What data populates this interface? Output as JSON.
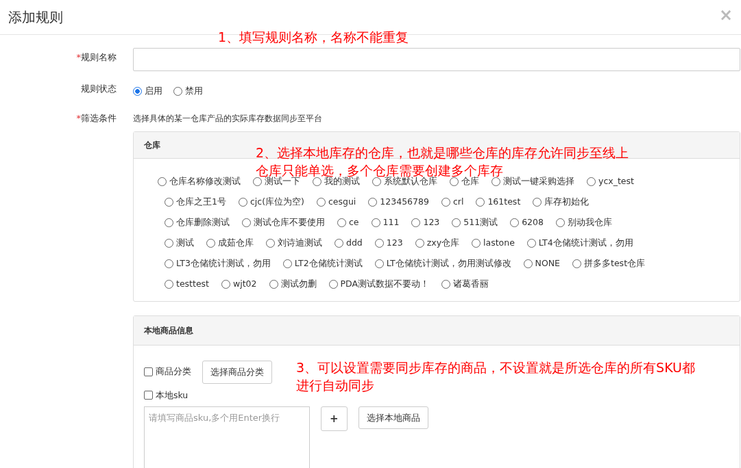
{
  "dialog": {
    "title": "添加规则",
    "close": "×"
  },
  "annotations": [
    {
      "lines": [
        "1、填写规则名称，名称不能重复"
      ]
    },
    {
      "lines": [
        "2、选择本地库存的仓库，也就是哪些仓库的库存允许同步至线上",
        "仓库只能单选，多个仓库需要创建多个库存"
      ]
    },
    {
      "lines": [
        "3、可以设置需要同步库存的商品，不设置就是所选仓库的所有SKU都",
        "进行自动同步"
      ]
    }
  ],
  "rule_name": {
    "required_mark": "*",
    "label": "规则名称"
  },
  "rule_status": {
    "label": "规则状态",
    "options": [
      {
        "label": "启用",
        "selected": true
      },
      {
        "label": "禁用",
        "selected": false
      }
    ]
  },
  "filter": {
    "required_mark": "*",
    "label": "筛选条件",
    "hint": "选择具体的某一仓库产品的实际库存数据同步至平台"
  },
  "warehouse_panel": {
    "title": "仓库",
    "rows": [
      {
        "options": [
          {
            "label": "仓库名称修改测试",
            "selected": false
          },
          {
            "label": "测试一下",
            "selected": false
          },
          {
            "label": "我的测试",
            "selected": false
          },
          {
            "label": "系统默认仓库",
            "selected": false
          },
          {
            "label": "仓库",
            "selected": false
          },
          {
            "label": "测试一键采购选择",
            "selected": false
          },
          {
            "label": "ycx_test",
            "selected": false
          }
        ]
      },
      {
        "options": [
          {
            "label": "仓库之王1号",
            "selected": false
          },
          {
            "label": "cjc(库位为空)",
            "selected": false
          },
          {
            "label": "cesgui",
            "selected": false
          },
          {
            "label": "123456789",
            "selected": false
          },
          {
            "label": "crl",
            "selected": false
          },
          {
            "label": "161test",
            "selected": false
          },
          {
            "label": "库存初始化",
            "selected": false
          }
        ]
      },
      {
        "options": [
          {
            "label": "仓库删除测试",
            "selected": false
          },
          {
            "label": "测试仓库不要使用",
            "selected": false
          },
          {
            "label": "ce",
            "selected": false
          },
          {
            "label": "111",
            "selected": false
          },
          {
            "label": "123",
            "selected": false
          },
          {
            "label": "511测试",
            "selected": false
          },
          {
            "label": "6208",
            "selected": false
          },
          {
            "label": "别动我仓库",
            "selected": false
          }
        ]
      },
      {
        "options": [
          {
            "label": "测试",
            "selected": false
          },
          {
            "label": "成茹仓库",
            "selected": false
          },
          {
            "label": "刘诗迪测试",
            "selected": false
          },
          {
            "label": "ddd",
            "selected": false
          },
          {
            "label": "123",
            "selected": false
          },
          {
            "label": "zxy仓库",
            "selected": false
          },
          {
            "label": "lastone",
            "selected": false
          },
          {
            "label": "LT4仓储统计测试，勿用",
            "selected": false
          }
        ]
      },
      {
        "options": [
          {
            "label": "LT3仓储统计测试，勿用",
            "selected": false
          },
          {
            "label": "LT2仓储统计测试",
            "selected": false
          },
          {
            "label": "LT仓储统计测试，勿用测试修改",
            "selected": false
          },
          {
            "label": "NONE",
            "selected": false
          },
          {
            "label": "拼多多test仓库",
            "selected": false
          }
        ]
      },
      {
        "options": [
          {
            "label": "testtest",
            "selected": false
          },
          {
            "label": "wjt02",
            "selected": false
          },
          {
            "label": "测试勿删",
            "selected": false
          },
          {
            "label": "PDA测试数据不要动！",
            "selected": false
          },
          {
            "label": "诸葛香丽",
            "selected": false
          }
        ]
      }
    ]
  },
  "product_panel": {
    "title": "本地商品信息",
    "category": {
      "label": "商品分类",
      "checked": false,
      "button": "选择商品分类"
    },
    "sku": {
      "label": "本地sku",
      "checked": false,
      "placeholder": "请填写商品sku,多个用Enter换行",
      "add_button": "+",
      "select_button": "选择本地商品"
    }
  }
}
